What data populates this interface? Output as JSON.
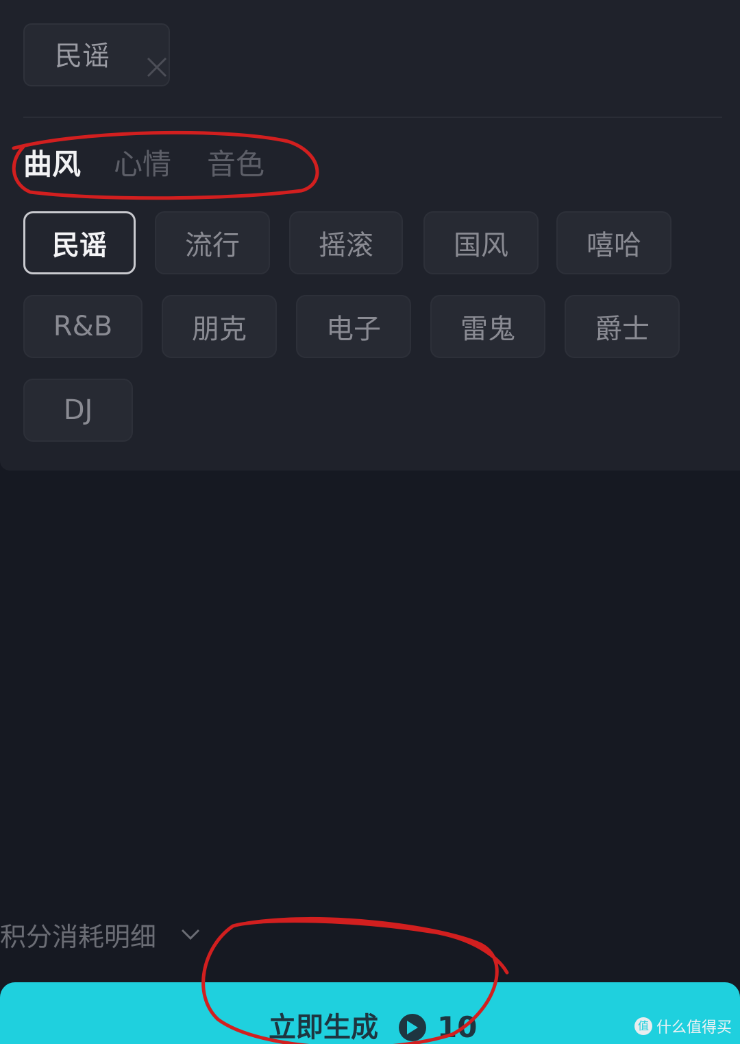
{
  "selected_tag": {
    "label": "民谣",
    "close_icon": "close-icon"
  },
  "tabs": [
    {
      "label": "曲风",
      "active": true
    },
    {
      "label": "心情",
      "active": false
    },
    {
      "label": "音色",
      "active": false
    }
  ],
  "tags": [
    {
      "label": "民谣",
      "active": true
    },
    {
      "label": "流行",
      "active": false
    },
    {
      "label": "摇滚",
      "active": false
    },
    {
      "label": "国风",
      "active": false
    },
    {
      "label": "嘻哈",
      "active": false
    },
    {
      "label": "R&B",
      "active": false
    },
    {
      "label": "朋克",
      "active": false
    },
    {
      "label": "电子",
      "active": false
    },
    {
      "label": "雷鬼",
      "active": false
    },
    {
      "label": "爵士",
      "active": false
    },
    {
      "label": "DJ",
      "active": false
    }
  ],
  "cost_detail": {
    "label": "积分消耗明细",
    "icon": "chevron-down-icon"
  },
  "generate": {
    "label": "立即生成",
    "cost": "10",
    "icon": "coin-icon"
  },
  "watermark": {
    "text": "什么值得买"
  },
  "colors": {
    "accent": "#1fd0de",
    "background": "#161922",
    "panel": "#1f222b",
    "annotation": "#d21f1f"
  }
}
